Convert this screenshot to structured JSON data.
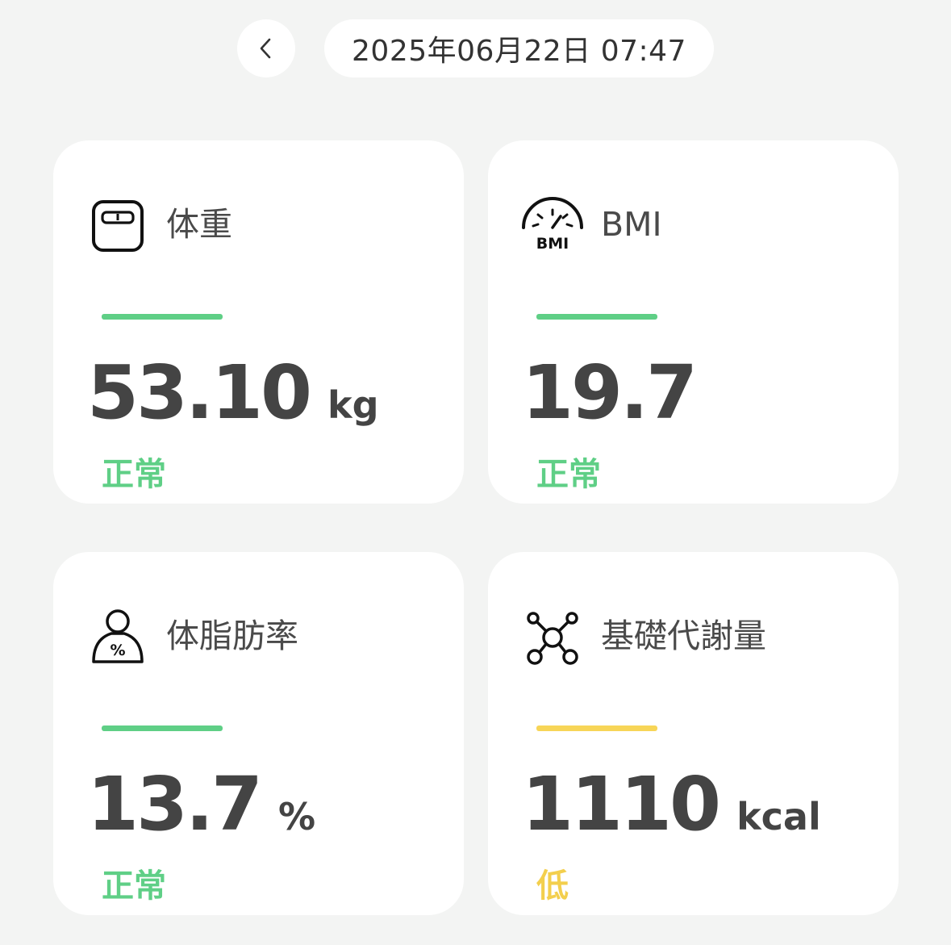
{
  "header": {
    "date_time": "2025年06月22日 07:47"
  },
  "colors": {
    "normal": "#5fcf86",
    "low": "#f3cf4d"
  },
  "cards": [
    {
      "label": "体重",
      "value": "53.10",
      "unit": "kg",
      "status": "正常",
      "icon": "scale-icon"
    },
    {
      "label": "BMI",
      "value": "19.7",
      "unit": "",
      "status": "正常",
      "icon": "bmi-gauge-icon",
      "icon_text": "BMI"
    },
    {
      "label": "体脂肪率",
      "value": "13.7",
      "unit": "%",
      "status": "正常",
      "icon": "body-fat-icon",
      "icon_text": "%"
    },
    {
      "label": "基礎代謝量",
      "value": "1110",
      "unit": "kcal",
      "status": "低",
      "icon": "metabolism-molecule-icon"
    }
  ]
}
